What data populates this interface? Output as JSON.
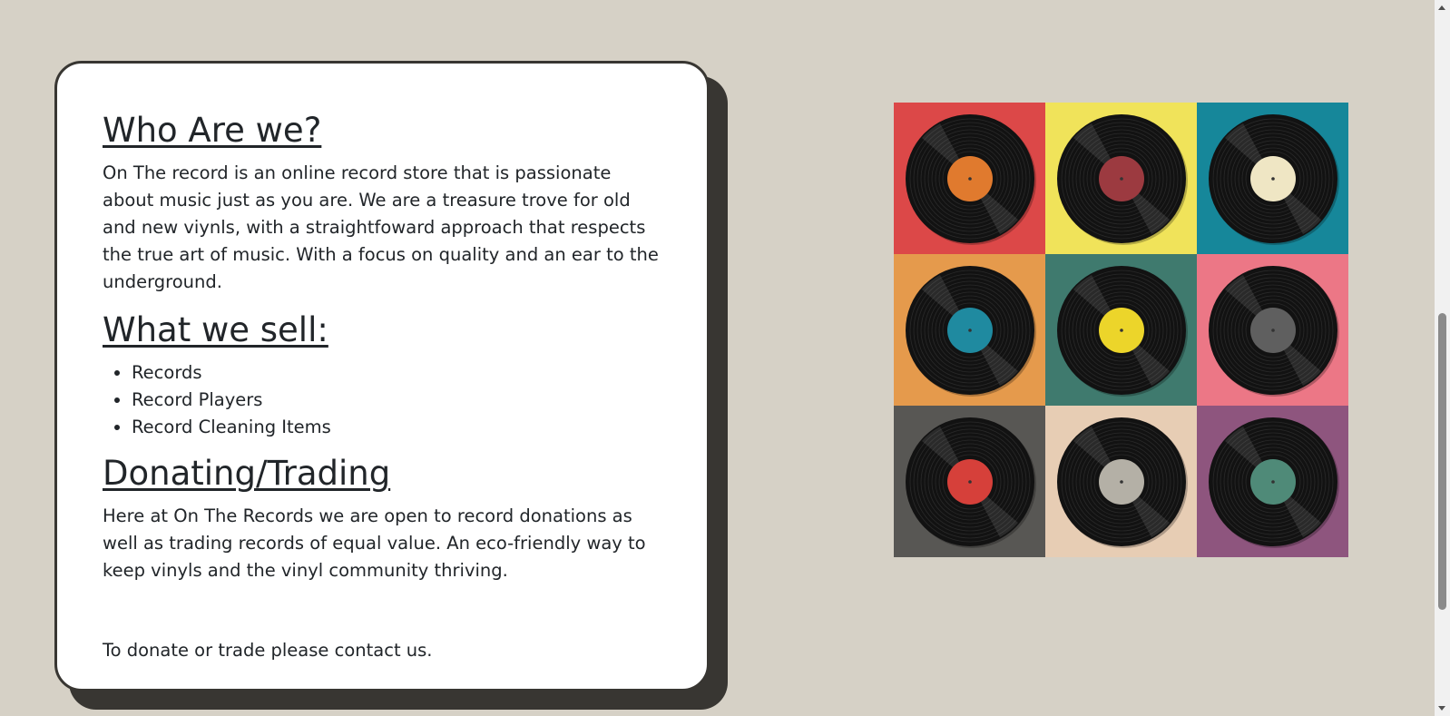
{
  "about": {
    "heading": "Who Are we?",
    "text": "On The record is an online record store that is passionate about music just as you are. We are a treasure trove for old and new viynls, with a straightfoward approach that respects the true art of music. With a focus on quality and an ear to the underground."
  },
  "sell": {
    "heading": "What we sell:",
    "items": [
      "Records",
      "Record Players",
      "Record Cleaning Items"
    ]
  },
  "donate": {
    "heading": "Donating/Trading",
    "text": "Here at On The Records we are open to record donations as well as trading records of equal value. An eco-friendly way to keep vinyls and the vinyl community thriving.",
    "contact": "To donate or trade please contact us."
  },
  "records_image": {
    "icon": "vinyl-records-grid",
    "tiles": [
      {
        "bg": "#dc4848",
        "label": "#e07a2e"
      },
      {
        "bg": "#f0e35a",
        "label": "#9c3a40"
      },
      {
        "bg": "#16879a",
        "label": "#efe6c4"
      },
      {
        "bg": "#e59a4c",
        "label": "#1f8aa0"
      },
      {
        "bg": "#3f7a6e",
        "label": "#ecd52a"
      },
      {
        "bg": "#ec7786",
        "label": "#5f5f5f"
      },
      {
        "bg": "#585754",
        "label": "#d6403a"
      },
      {
        "bg": "#e7cdb4",
        "label": "#b4b0a6"
      },
      {
        "bg": "#8e557e",
        "label": "#4f8a78"
      }
    ]
  }
}
